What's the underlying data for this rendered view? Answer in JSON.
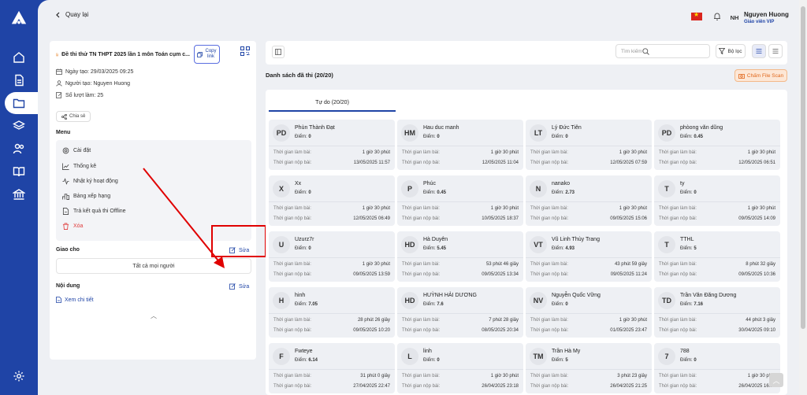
{
  "header": {
    "back_label": "Quay lại",
    "user_initials": "NH",
    "user_name": "Nguyen Huong",
    "user_role": "Giáo viên VIP"
  },
  "exam": {
    "title": "Đề thi thử TN THPT 2025 lần 1 môn Toán cụm c...",
    "copy_label": "Copy link",
    "created_at": "Ngày tạo: 29/03/2025 09:25",
    "creator": "Người tạo: Nguyen Huong",
    "attempts": "Số lượt làm: 25",
    "share_label": "Chia sẻ"
  },
  "menu": {
    "title": "Menu",
    "items": [
      {
        "label": "Cài đặt",
        "icon": "gear-icon"
      },
      {
        "label": "Thống kê",
        "icon": "chart-icon"
      },
      {
        "label": "Nhật ký hoạt động",
        "icon": "activity-icon"
      },
      {
        "label": "Bảng xếp hạng",
        "icon": "ranking-icon"
      },
      {
        "label": "Trả kết quả thi Offline",
        "icon": "document-icon"
      },
      {
        "label": "Xóa",
        "icon": "trash-icon"
      }
    ]
  },
  "assign": {
    "title": "Giao cho",
    "edit_label": "Sửa",
    "value": "Tất cả mọi người"
  },
  "content": {
    "title": "Nội dung",
    "edit_label": "Sửa",
    "detail_label": "Xem chi tiết"
  },
  "toolbar": {
    "search_placeholder": "Tìm kiếm",
    "filter_label": "Bộ lọc"
  },
  "list": {
    "title": "Danh sách đã thi (20/20)",
    "scan_label": "Chấm File Scan",
    "tab_label": "Tự do (20/20)",
    "time_label": "Thời gian làm bài:",
    "submit_label": "Thời gian nộp bài:",
    "score_label": "Điểm:",
    "students": [
      {
        "initials": "PD",
        "name": "Phùn Thành Đạt",
        "score": "0",
        "duration": "1 giờ 30 phút",
        "submitted": "13/05/2025 11:57"
      },
      {
        "initials": "HM",
        "name": "Hau duc manh",
        "score": "0",
        "duration": "1 giờ 30 phút",
        "submitted": "12/05/2025 11:04"
      },
      {
        "initials": "LT",
        "name": "Lý Đức Tiên",
        "score": "0",
        "duration": "1 giờ 30 phút",
        "submitted": "12/05/2025 07:59"
      },
      {
        "initials": "PD",
        "name": "phòong văn dũng",
        "score": "0.45",
        "duration": "1 giờ 30 phút",
        "submitted": "12/05/2025 06:51"
      },
      {
        "initials": "X",
        "name": "Xx",
        "score": "0",
        "duration": "1 giờ 30 phút",
        "submitted": "12/05/2025 06:49"
      },
      {
        "initials": "P",
        "name": "Phúc",
        "score": "0.45",
        "duration": "1 giờ 30 phút",
        "submitted": "10/05/2025 18:37"
      },
      {
        "initials": "N",
        "name": "nanako",
        "score": "2.73",
        "duration": "1 giờ 30 phút",
        "submitted": "09/05/2025 15:06"
      },
      {
        "initials": "T",
        "name": "ty",
        "score": "0",
        "duration": "1 giờ 30 phút",
        "submitted": "09/05/2025 14:09"
      },
      {
        "initials": "U",
        "name": "Uzurz7r",
        "score": "0",
        "duration": "1 giờ 30 phút",
        "submitted": "09/05/2025 13:59"
      },
      {
        "initials": "HD",
        "name": "Hà Duyên",
        "score": "5.45",
        "duration": "53 phút 46 giây",
        "submitted": "09/05/2025 13:34"
      },
      {
        "initials": "VT",
        "name": "Vũ Linh Thùy Trang",
        "score": "4.93",
        "duration": "43 phút 59 giây",
        "submitted": "09/05/2025 11:24"
      },
      {
        "initials": "T",
        "name": "TTHL",
        "score": "5",
        "duration": "8 phút 32 giây",
        "submitted": "09/05/2025 10:36"
      },
      {
        "initials": "H",
        "name": "hinh",
        "score": "7.05",
        "duration": "28 phút 26 giây",
        "submitted": "09/05/2025 10:20"
      },
      {
        "initials": "HD",
        "name": "HUỲNH HẢI DƯƠNG",
        "score": "7.6",
        "duration": "7 phút 28 giây",
        "submitted": "08/05/2025 20:34"
      },
      {
        "initials": "NV",
        "name": "Nguyễn Quốc Vững",
        "score": "0",
        "duration": "1 giờ 30 phút",
        "submitted": "01/05/2025 23:47"
      },
      {
        "initials": "TD",
        "name": "Trần Văn Đăng Dương",
        "score": "7.16",
        "duration": "44 phút 3 giây",
        "submitted": "30/04/2025 09:10"
      },
      {
        "initials": "F",
        "name": "Fwteye",
        "score": "6.14",
        "duration": "31 phút 0 giây",
        "submitted": "27/04/2025 22:47"
      },
      {
        "initials": "L",
        "name": "linh",
        "score": "0",
        "duration": "1 giờ 30 phút",
        "submitted": "26/04/2025 23:18"
      },
      {
        "initials": "TM",
        "name": "Trần Hà My",
        "score": "5",
        "duration": "3 phút 23 giây",
        "submitted": "26/04/2025 21:25"
      },
      {
        "initials": "7",
        "name": "788",
        "score": "0",
        "duration": "1 giờ 30 phút",
        "submitted": "26/04/2025 16:14"
      }
    ]
  },
  "colors": {
    "primary": "#1f44a6",
    "danger": "#e03b3b",
    "annotation": "#e00000",
    "scan": "#e0671b"
  }
}
